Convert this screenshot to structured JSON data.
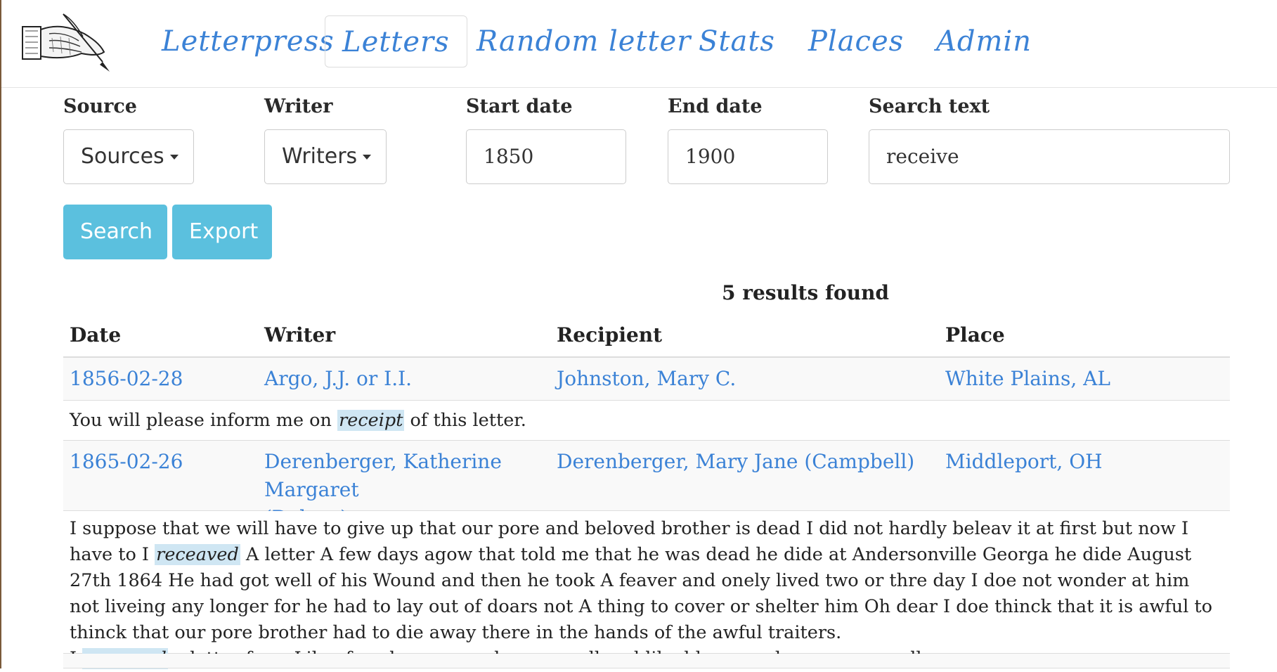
{
  "nav": {
    "logo_icon": "hand-writing-quill-icon",
    "links": [
      "Letterpress",
      "Letters",
      "Random letter",
      "Stats",
      "Places",
      "Admin"
    ],
    "active": "Letters"
  },
  "filters": {
    "source_label": "Source",
    "source_value": "Sources",
    "writer_label": "Writer",
    "writer_value": "Writers",
    "start_label": "Start date",
    "start_value": "1850",
    "end_label": "End date",
    "end_value": "1900",
    "search_label": "Search text",
    "search_value": "receive"
  },
  "buttons": {
    "search": "Search",
    "export": "Export"
  },
  "results": {
    "count_text": "5 results found",
    "headers": [
      "Date",
      "Writer",
      "Recipient",
      "Place"
    ],
    "rows": [
      {
        "date": "1856-02-28",
        "writer": "Argo, J.J. or I.I.",
        "recipient": "Johnston, Mary C.",
        "place": "White Plains, AL",
        "snippet": {
          "pre": "You will please inform me on ",
          "hl": "receipt",
          "post": " of this letter."
        }
      },
      {
        "date": "1865-02-26",
        "writer": "Derenberger, Katherine Margaret",
        "writer_line2": "(Dolsen)",
        "recipient": "Derenberger, Mary Jane (Campbell)",
        "place": "Middleport, OH",
        "snippet": {
          "p1_pre": "I suppose that we will have to give up that our pore and beloved brother is dead I did not hardly beleav it at first but now I have to I ",
          "p1_hl": "receaved",
          "p1_post": " A letter A few days agow that told me that he was dead he dide at Andersonville Georga he dide August 27th 1864 He had got well of his Wound and then he took A feaver and onely lived two or thre day I doe not wonder at him not liveing any longer for he had to lay out of doars not A thing to cover or shelter him Oh dear I doe thinck that it is awful to thinck that our pore brother had to die away there in the hands of the awful traiters.",
          "p2_pre": "I ",
          "p2_hl": "receaved",
          "p2_post": " a letter from Lib a few days agow she was well and liked her new home verry well."
        }
      }
    ]
  }
}
